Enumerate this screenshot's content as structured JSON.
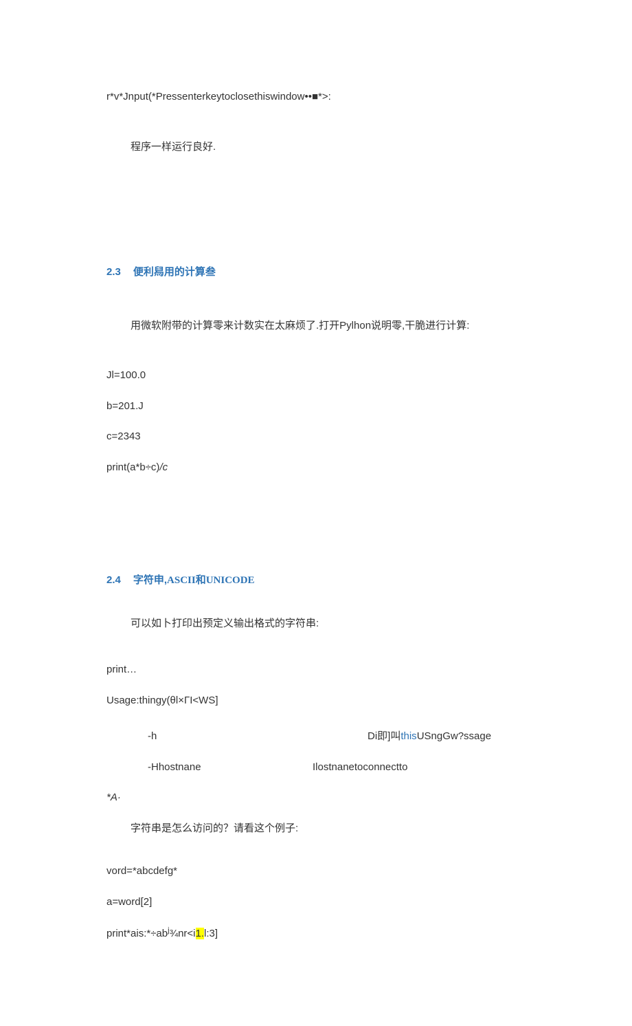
{
  "line_top": "r*v*Jnput(*Pressenterkeytoclosethiswindow••■*>:",
  "para1": "程序一样运行良好.",
  "sec23": {
    "num": "2.3",
    "title": "便利舄用的计算叁"
  },
  "para23": "用微软附带的计算零来计数实在太麻烦了.打开Pylhon说明零,干脆进行计算:",
  "code23": {
    "l1": "Jl=100.0",
    "l2": "b=201.J",
    "l3": "c=2343",
    "l4_a": "print(a*b÷c)",
    "l4_b": "/c"
  },
  "sec24": {
    "num": "2.4",
    "title_a": "字符申,",
    "title_b": "ASCII和UNICODE"
  },
  "para24a": "可以如卜打印出预定义输出格式的字符串:",
  "code24a": {
    "l1": "print…",
    "l2": "Usage:thingy(θl×ΓI<WS]",
    "row1_left": "-h",
    "row1_right_a": "Di即]叫",
    "row1_right_link": "this",
    "row1_right_b": "USngGw?ssage",
    "row2_left": "-Hhostnane",
    "row2_right": "Ilostnanetoconnectto",
    "l5": "*A·"
  },
  "para24b": "字符串是怎么访问的？请看这个例子:",
  "code24b": {
    "l1": "vord=*abcdefg*",
    "l2": "a=word[2]",
    "l3_a": "print*ais:*÷ab",
    "l3_sup": "j",
    "l3_b": "¾nr<i",
    "l3_hl": "1.",
    "l3_c": "l:3]"
  }
}
